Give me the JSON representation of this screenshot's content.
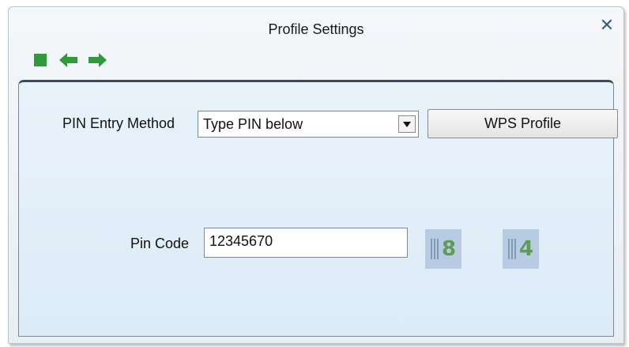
{
  "window": {
    "title": "Profile Settings",
    "close_glyph": "✕"
  },
  "toolbar": {
    "items": [
      {
        "name": "stop-icon",
        "color": "#2e9a3a"
      },
      {
        "name": "back-arrow-icon",
        "color": "#2e9a3a"
      },
      {
        "name": "forward-arrow-icon",
        "color": "#2e9a3a"
      }
    ]
  },
  "form": {
    "pin_method_label": "PIN Entry Method",
    "pin_method_value": "Type PIN below",
    "wps_button_label": "WPS Profile",
    "pin_code_label": "Pin Code",
    "pin_code_value": "12345670"
  },
  "badges": [
    {
      "digit": "8"
    },
    {
      "digit": "4"
    }
  ],
  "colors": {
    "panel_bg": "#dcebf7",
    "accent_green": "#2e9a3a",
    "badge_bg": "#b7cbe3"
  }
}
